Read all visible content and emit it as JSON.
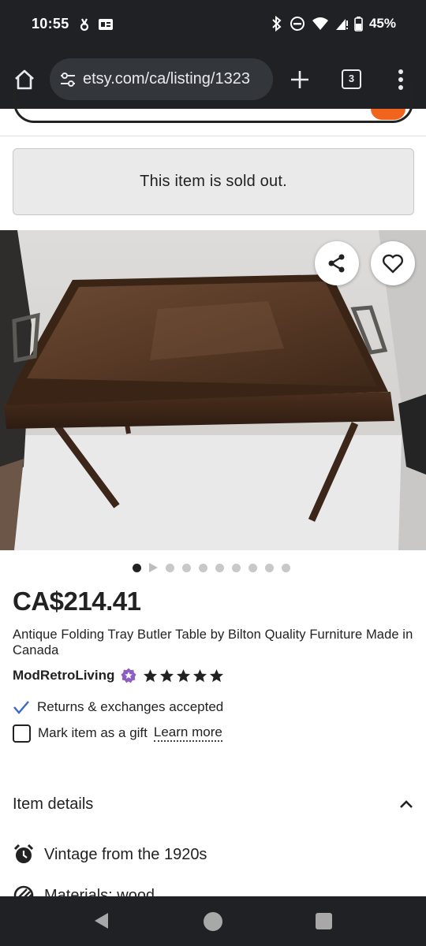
{
  "status_bar": {
    "time": "10:55",
    "battery": "45%",
    "icons": [
      "notification-icon",
      "sim-card-icon",
      "bluetooth-icon",
      "do-not-disturb-icon",
      "wifi-icon",
      "signal-icon",
      "battery-icon"
    ]
  },
  "browser": {
    "url": "etsy.com/ca/listing/1323",
    "tab_count": "3"
  },
  "listing": {
    "sold_out_message": "This item is sold out.",
    "price": "CA$214.41",
    "title": "Antique Folding Tray Butler Table by Bilton Quality Furniture Made in Canada",
    "seller": "ModRetroLiving",
    "rating_stars": 5,
    "returns": "Returns & exchanges accepted",
    "gift_label": "Mark item as a gift",
    "learn_more": "Learn more",
    "image_count": 10,
    "active_image": 1
  },
  "item_details": {
    "heading": "Item details",
    "vintage": "Vintage from the 1920s",
    "materials": "Materials: wood"
  },
  "colors": {
    "etsy_orange": "#f1641e",
    "star_seller_purple": "#8c5ec2",
    "link_blue": "#3b67c9",
    "system_bar": "#1f2125"
  }
}
